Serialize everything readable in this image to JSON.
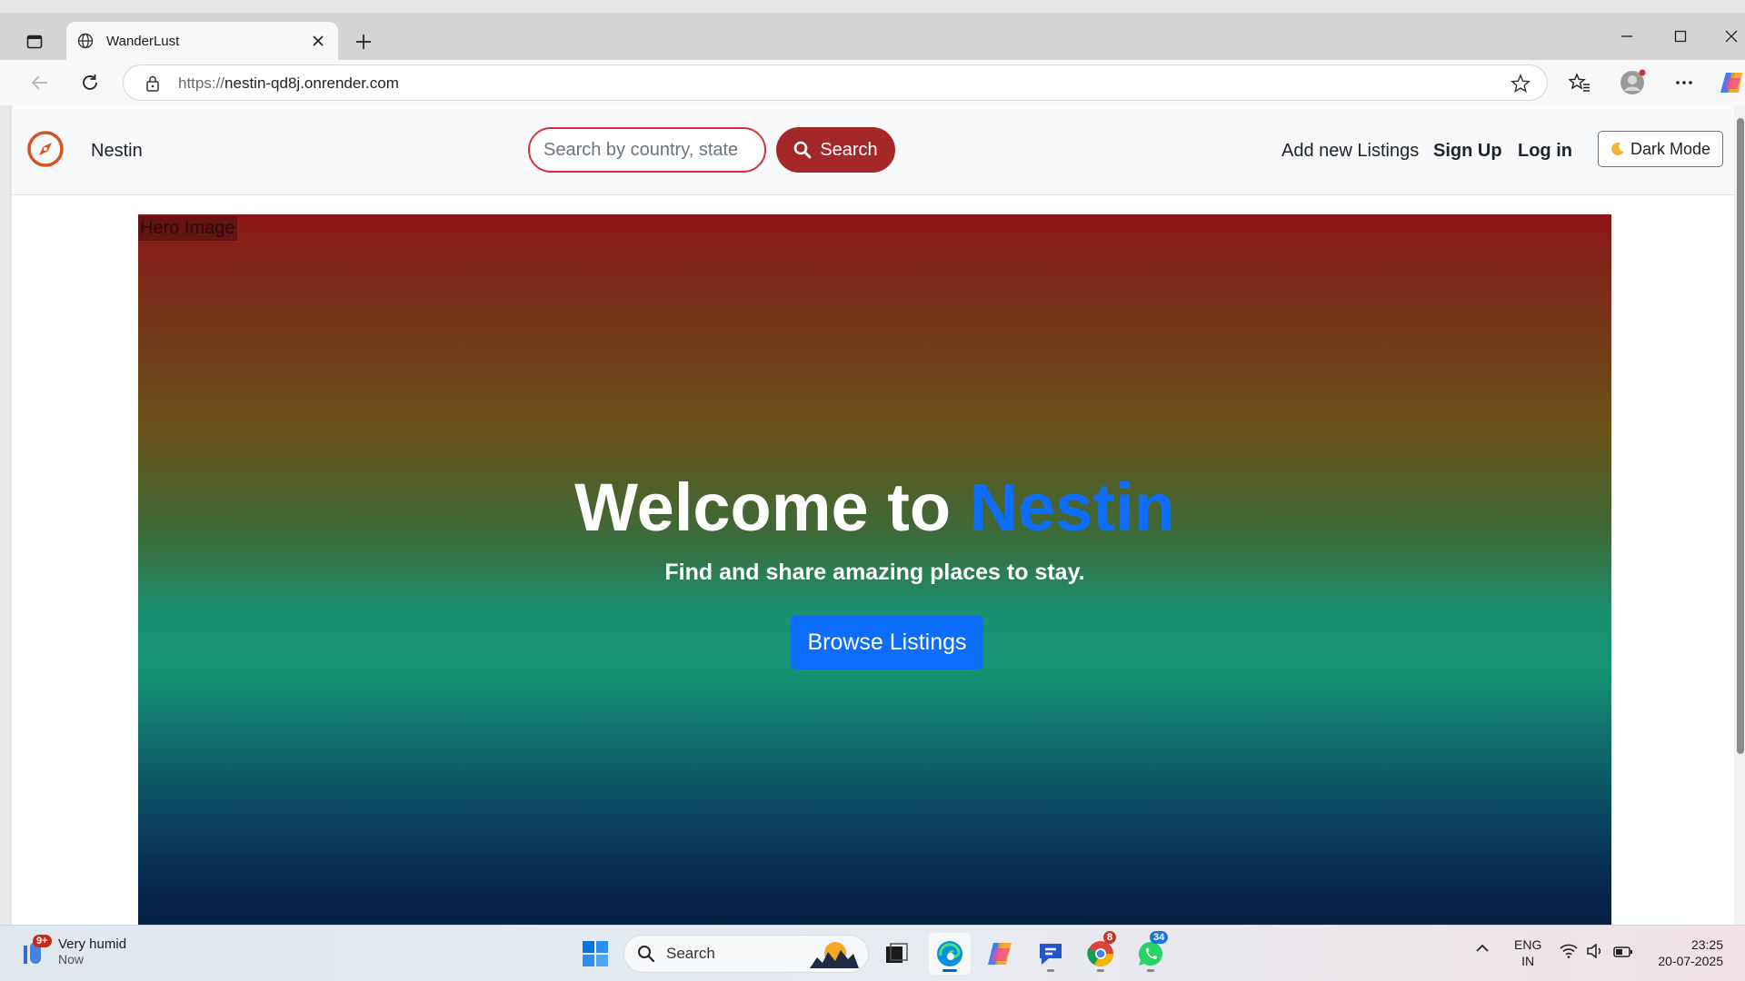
{
  "browser": {
    "tab_title": "WanderLust",
    "url_scheme": "https://",
    "url_host": "nestin-qd8j.onrender.com"
  },
  "site": {
    "brand": "Nestin",
    "search_placeholder": "Search by country, state",
    "search_button": "Search",
    "nav": {
      "add_listing": "Add new Listings",
      "sign_up": "Sign Up",
      "log_in": "Log in",
      "dark_mode": "Dark Mode"
    },
    "hero": {
      "image_alt": "Hero Image",
      "title_prefix": "Welcome to ",
      "title_accent": "Nestin",
      "subtitle": "Find and share amazing places to stay.",
      "cta": "Browse Listings"
    }
  },
  "taskbar": {
    "weather_badge": "9+",
    "weather_title": "Very humid",
    "weather_time": "Now",
    "search_label": "Search",
    "chrome_badge": "8",
    "whatsapp_badge": "34",
    "lang_line1": "ENG",
    "lang_line2": "IN",
    "time": "23:25",
    "date": "20-07-2025"
  },
  "colors": {
    "brand_accent": "#0d6efd",
    "search_button": "#a42828",
    "search_border": "#d63040",
    "brand_icon": "#d9531e"
  },
  "icons": [
    "tab-sidebar-icon",
    "globe-icon",
    "close-icon",
    "plus-icon",
    "minimize-icon",
    "maximize-icon",
    "back-icon",
    "reload-icon",
    "lock-icon",
    "star-icon",
    "favorites-icon",
    "profile-icon",
    "more-icon",
    "copilot-icon",
    "compass-icon",
    "search-icon",
    "moon-icon",
    "windows-start-icon",
    "task-view-icon",
    "edge-icon",
    "chrome-icon",
    "whatsapp-icon",
    "wifi-icon",
    "volume-icon",
    "battery-icon"
  ]
}
